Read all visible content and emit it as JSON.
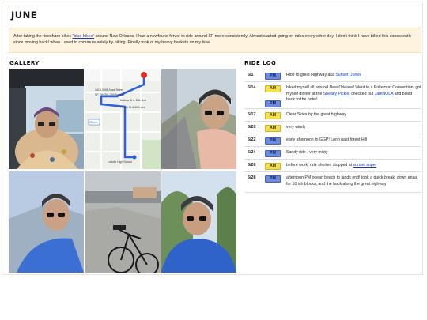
{
  "page": {
    "title": "JUNE",
    "intro": {
      "before": "After taking the rideshare bikes ",
      "link": "\"blue bikes\"",
      "after": " around New Orleans, I had a newfound fervor to ride around SF more consistently! Almost started going on rides every other day. I don't think I have biked this consistently since moving back/ when I used to commute solely by biking. Finally took of my heavy baskets on my bike."
    }
  },
  "gallery": {
    "heading": "GALLERY",
    "map": {
      "labels": [
        "3410-3401 Anza Street",
        "SF, 7th 301-300 Avenue",
        "Balboa St & 30th Ave",
        "Fulton St & 30th Ave",
        "Lincoln High School"
      ],
      "eta": "25 min"
    }
  },
  "ridelog": {
    "heading": "RIDE LOG",
    "rows": [
      {
        "date": "6/1",
        "time": "PM",
        "parts": [
          "Ride to great Highway aka ",
          "Sunset Dunes",
          ""
        ]
      },
      {
        "date": "6/14",
        "time": "AM",
        "time2": "PM",
        "parts": [
          "biked myself all around New Orleans! Went to a Pokemon Convention, got myself dinner at the ",
          "Sneaky Pickle",
          ", checked out ",
          "JamNOLA",
          " and biked back to the hotel!"
        ]
      },
      {
        "date": "6/17",
        "time": "AM",
        "parts": [
          "Clear Skies by the great highway"
        ]
      },
      {
        "date": "6/20",
        "time": "AM",
        "parts": [
          "very windy"
        ]
      },
      {
        "date": "6/22",
        "time": "PM",
        "parts": [
          "early afternoon to GGP! Loop past forest Hill"
        ]
      },
      {
        "date": "6/24",
        "time": "PM",
        "parts": [
          "Sandy ride , very misty"
        ]
      },
      {
        "date": "6/26",
        "time": "AM",
        "parts": [
          "before work, ride shorter, stopped at ",
          "sunset super",
          ""
        ]
      },
      {
        "date": "6/28",
        "time": "PM",
        "parts": [
          "afternoon PM ocean beach to lands end! took a quick break, down anza for 10 ish blocks, and the back along the great highway"
        ]
      }
    ]
  }
}
